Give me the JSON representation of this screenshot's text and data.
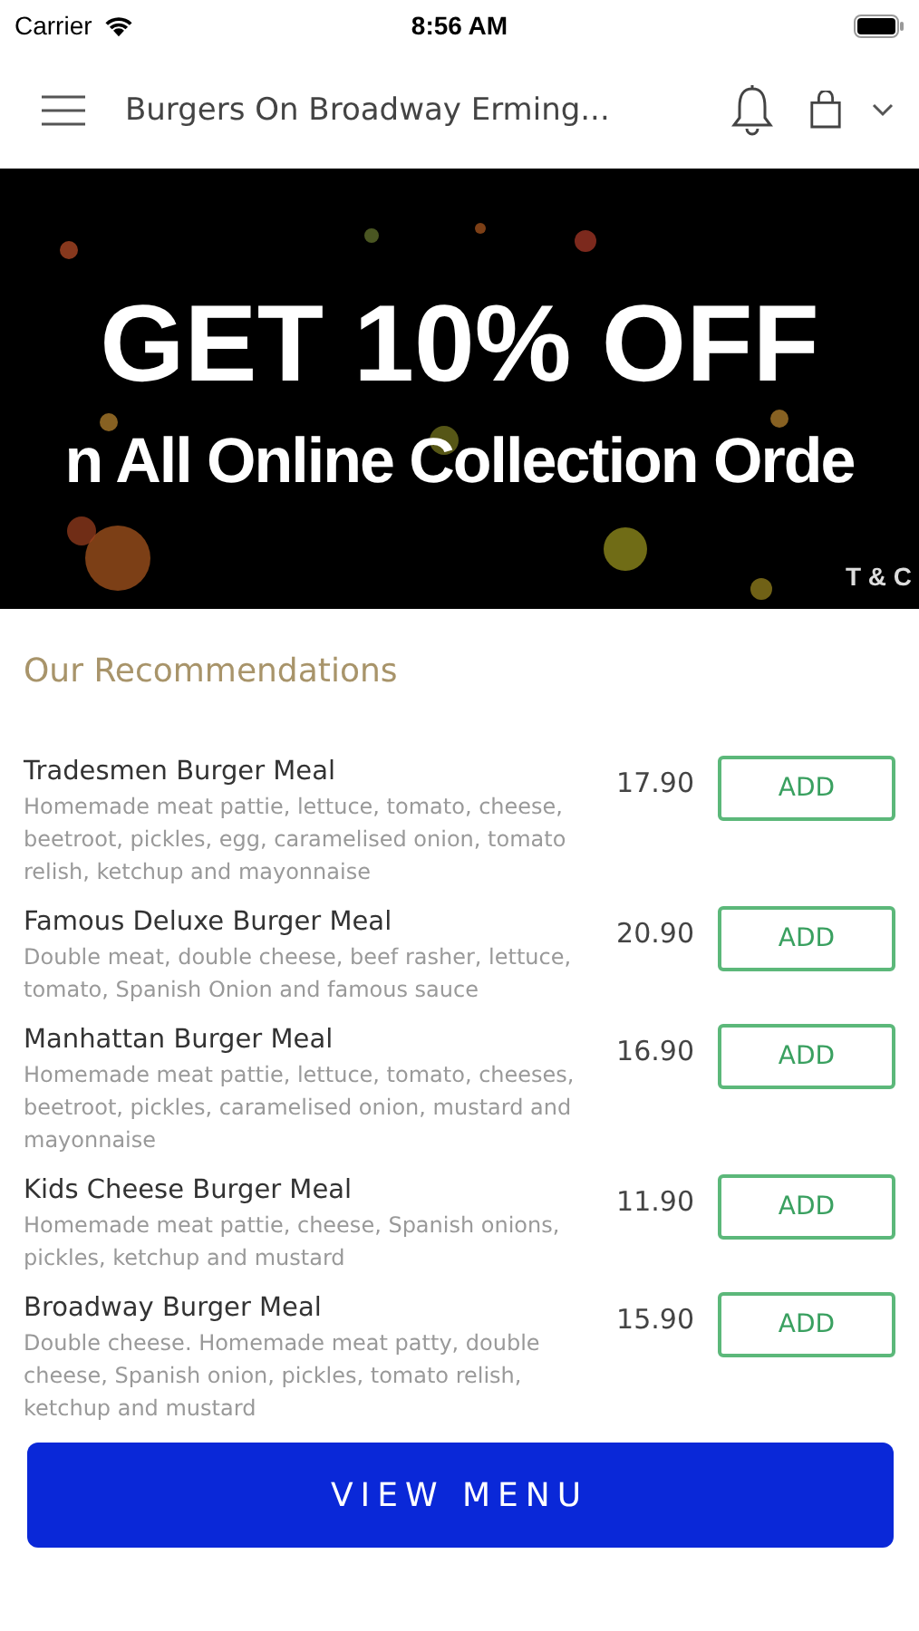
{
  "status_bar": {
    "carrier": "Carrier",
    "time": "8:56 AM"
  },
  "header": {
    "title": "Burgers On Broadway  Erming..."
  },
  "banner": {
    "kind": "picture",
    "headline": "GET 10% OFF",
    "subline": "n All Online Collection Orde",
    "note": "T & C"
  },
  "section_title": "Our Recommendations",
  "items": [
    {
      "name": "Tradesmen Burger Meal",
      "description": "Homemade meat pattie, lettuce, tomato, cheese, beetroot, pickles, egg, caramelised onion, tomato relish, ketchup and mayonnaise",
      "price": "17.90",
      "button": "ADD"
    },
    {
      "name": "Famous Deluxe Burger Meal",
      "description": "Double meat, double cheese, beef rasher, lettuce, tomato, Spanish Onion and famous sauce",
      "price": "20.90",
      "button": "ADD"
    },
    {
      "name": "Manhattan Burger Meal",
      "description": "Homemade meat pattie, lettuce, tomato, cheeses, beetroot, pickles, caramelised onion, mustard and mayonnaise",
      "price": "16.90",
      "button": "ADD"
    },
    {
      "name": "Kids Cheese Burger Meal",
      "description": "Homemade meat pattie, cheese, Spanish onions, pickles, ketchup and mustard",
      "price": "11.90",
      "button": "ADD"
    },
    {
      "name": "Broadway Burger Meal",
      "description": "Double cheese. Homemade meat patty, double cheese, Spanish onion, pickles, tomato relish, ketchup and mustard",
      "price": "15.90",
      "button": "ADD"
    }
  ],
  "primary_button": "VIEW MENU"
}
